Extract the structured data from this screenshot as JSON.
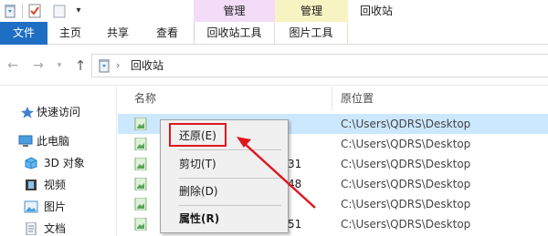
{
  "titlebar": {
    "contextual_groups": [
      "管理",
      "管理"
    ],
    "window_title": "回收站"
  },
  "ribbon": {
    "tabs": [
      "文件",
      "主页",
      "共享",
      "查看",
      "回收站工具",
      "图片工具"
    ]
  },
  "address": {
    "location": "回收站"
  },
  "nav_pane": {
    "quick_access": "快速访问",
    "this_pc": "此电脑",
    "items": [
      "3D 对象",
      "视频",
      "图片",
      "文档"
    ]
  },
  "file_list": {
    "columns": [
      "名称",
      "原位置"
    ],
    "rows": [
      {
        "tail": "",
        "location": "C:\\Users\\QDRS\\Desktop",
        "selected": true
      },
      {
        "tail": "",
        "location": "C:\\Users\\QDRS\\Desktop",
        "selected": false
      },
      {
        "tail": "31",
        "location": "C:\\Users\\QDRS\\Desktop",
        "selected": false
      },
      {
        "tail": "48",
        "location": "C:\\Users\\QDRS\\Desktop",
        "selected": false
      },
      {
        "tail": "",
        "location": "C:\\Users\\QDRS\\Desktop",
        "selected": false
      },
      {
        "tail": "51",
        "location": "C:\\Users\\QDRS\\Desktop",
        "selected": false
      }
    ]
  },
  "context_menu": {
    "restore": "还原(E)",
    "cut": "剪切(T)",
    "delete": "删除(D)",
    "properties": "属性(R)"
  },
  "colors": {
    "file_tab": "#1e6fc4",
    "manage_recycle": "#f3dcf7",
    "manage_picture": "#f7f3c2",
    "selection": "#cce8ff",
    "annotation": "#e0161e"
  }
}
